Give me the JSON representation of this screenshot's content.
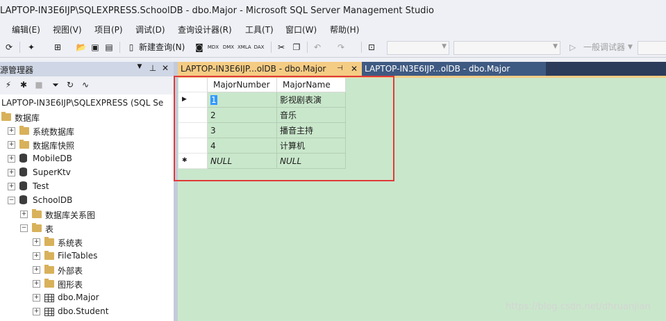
{
  "window": {
    "title": "LAPTOP-IN3E6IJP\\SQLEXPRESS.SchoolDB - dbo.Major - Microsoft SQL Server Management Studio"
  },
  "menu": [
    "编辑(E)",
    "视图(V)",
    "项目(P)",
    "调试(D)",
    "查询设计器(R)",
    "工具(T)",
    "窗口(W)",
    "帮助(H)"
  ],
  "toolbar": {
    "new_query": "新建查询(N)",
    "debugger": "一般调试器",
    "icon_labels": [
      "MDX",
      "DMX",
      "XMLA",
      "DAX"
    ]
  },
  "object_explorer": {
    "title": "源管理器",
    "tree": [
      {
        "label": "LAPTOP-IN3E6IJP\\SQLEXPRESS (SQL Se",
        "icon": "server-icon",
        "expand": ""
      },
      {
        "label": "数据库",
        "icon": "folder-icon",
        "expand": ""
      },
      {
        "label": "系统数据库",
        "icon": "folder-icon",
        "expand": "+"
      },
      {
        "label": "数据库快照",
        "icon": "folder-icon",
        "expand": "+"
      },
      {
        "label": "MobileDB",
        "icon": "database-icon",
        "expand": "+"
      },
      {
        "label": "SuperKtv",
        "icon": "database-icon",
        "expand": "+"
      },
      {
        "label": "Test",
        "icon": "database-icon",
        "expand": "+"
      },
      {
        "label": "SchoolDB",
        "icon": "database-icon",
        "expand": "−"
      },
      {
        "label": "数据库关系图",
        "icon": "folder-icon",
        "expand": "+"
      },
      {
        "label": "表",
        "icon": "folder-icon",
        "expand": "−"
      },
      {
        "label": "系统表",
        "icon": "folder-icon",
        "expand": "+"
      },
      {
        "label": "FileTables",
        "icon": "folder-icon",
        "expand": "+"
      },
      {
        "label": "外部表",
        "icon": "folder-icon",
        "expand": "+"
      },
      {
        "label": "图形表",
        "icon": "folder-icon",
        "expand": "+"
      },
      {
        "label": "dbo.Major",
        "icon": "table-icon",
        "expand": "+"
      },
      {
        "label": "dbo.Student",
        "icon": "table-icon",
        "expand": "+"
      }
    ]
  },
  "tabs": [
    {
      "label": "LAPTOP-IN3E6IJP...olDB - dbo.Major",
      "active": true
    },
    {
      "label": "LAPTOP-IN3E6IJP...olDB - dbo.Major",
      "active": false
    }
  ],
  "grid": {
    "columns": [
      "MajorNumber",
      "MajorName"
    ],
    "rows": [
      [
        "1",
        "影视剧表演"
      ],
      [
        "2",
        "音乐"
      ],
      [
        "3",
        "播音主持"
      ],
      [
        "4",
        "计算机"
      ],
      [
        "NULL",
        "NULL"
      ]
    ],
    "row_markers": [
      "▶",
      "",
      "",
      "",
      "✱"
    ]
  },
  "watermark": "https://blog.csdn.net/dhruanjian"
}
